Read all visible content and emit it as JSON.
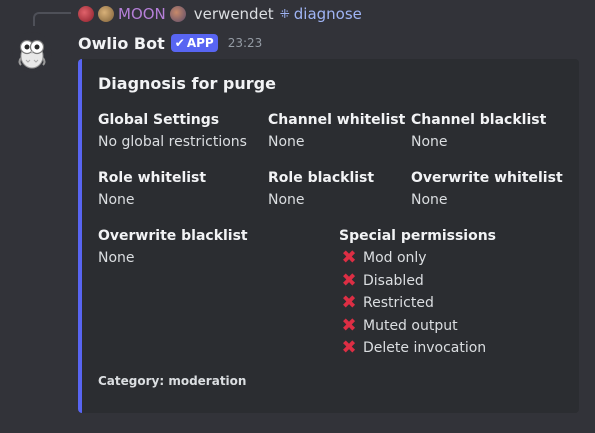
{
  "reply": {
    "user": "MOON",
    "action_text": "verwendet",
    "command": "diagnose"
  },
  "author": {
    "name": "Owlio Bot",
    "badge": "APP",
    "time": "23:23"
  },
  "embed": {
    "accent_color": "#5865f2",
    "title": "Diagnosis for purge",
    "fields": [
      {
        "name": "Global Settings",
        "value": "No global restrictions"
      },
      {
        "name": "Channel whitelist",
        "value": "None"
      },
      {
        "name": "Channel blacklist",
        "value": "None"
      },
      {
        "name": "Role whitelist",
        "value": "None"
      },
      {
        "name": "Role blacklist",
        "value": "None"
      },
      {
        "name": "Overwrite whitelist",
        "value": "None"
      },
      {
        "name": "Overwrite blacklist",
        "value": "None"
      }
    ],
    "special_permissions": {
      "name": "Special permissions",
      "items": [
        "Mod only",
        "Disabled",
        "Restricted",
        "Muted output",
        "Delete invocation"
      ]
    },
    "footer": "Category: moderation"
  }
}
